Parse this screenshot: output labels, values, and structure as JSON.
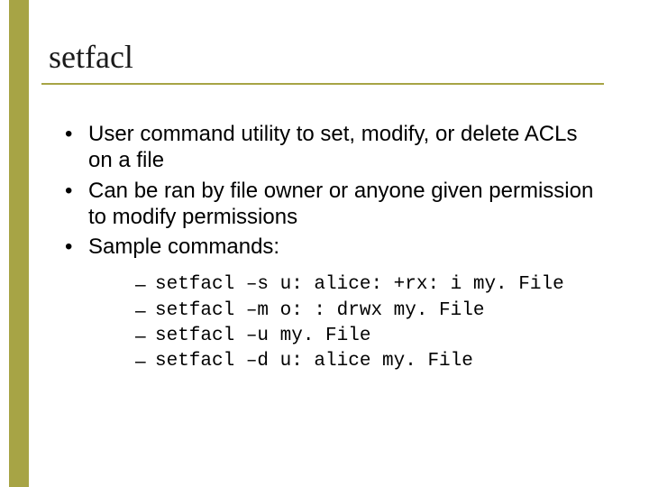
{
  "title": "setfacl",
  "bullets": [
    "User command utility to set, modify, or delete ACLs on a file",
    "Can be ran by file owner or anyone given permission to modify permissions",
    "Sample commands:"
  ],
  "commands": [
    "setfacl –s u: alice: +rx: i my. File",
    "setfacl –m o: : drwx my. File",
    "setfacl –u my. File",
    "setfacl –d u: alice my. File"
  ]
}
